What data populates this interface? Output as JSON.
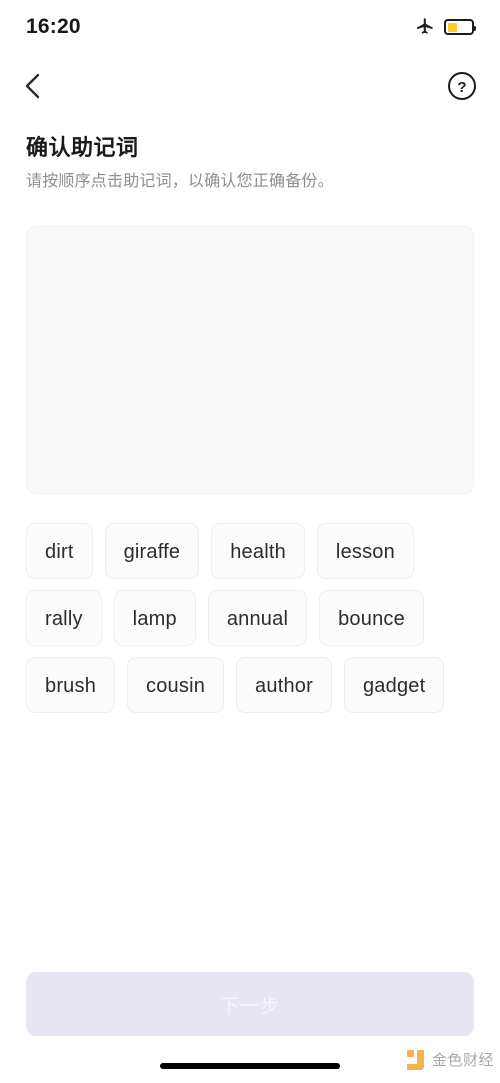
{
  "status_bar": {
    "time": "16:20",
    "airplane_icon": "airplane-mode-icon",
    "battery_icon": "battery-icon",
    "battery_level_percent": 40,
    "battery_color": "#ffcc2e"
  },
  "nav": {
    "back_icon": "chevron-left-icon",
    "help_icon": "question-mark-circle-icon"
  },
  "header": {
    "title": "确认助记词",
    "subtitle": "请按顺序点击助记词，以确认您正确备份。"
  },
  "selection_card": {
    "selected_words": []
  },
  "word_bank": {
    "words": [
      "dirt",
      "giraffe",
      "health",
      "lesson",
      "rally",
      "lamp",
      "annual",
      "bounce",
      "brush",
      "cousin",
      "author",
      "gadget"
    ]
  },
  "footer": {
    "next_button_label": "下一步",
    "next_button_enabled": false,
    "next_button_color": "#e8e6f3"
  },
  "watermark": {
    "text": "金色财经",
    "logo_icon": "jinse-finance-logo-icon",
    "logo_color": "#f0a92c"
  }
}
